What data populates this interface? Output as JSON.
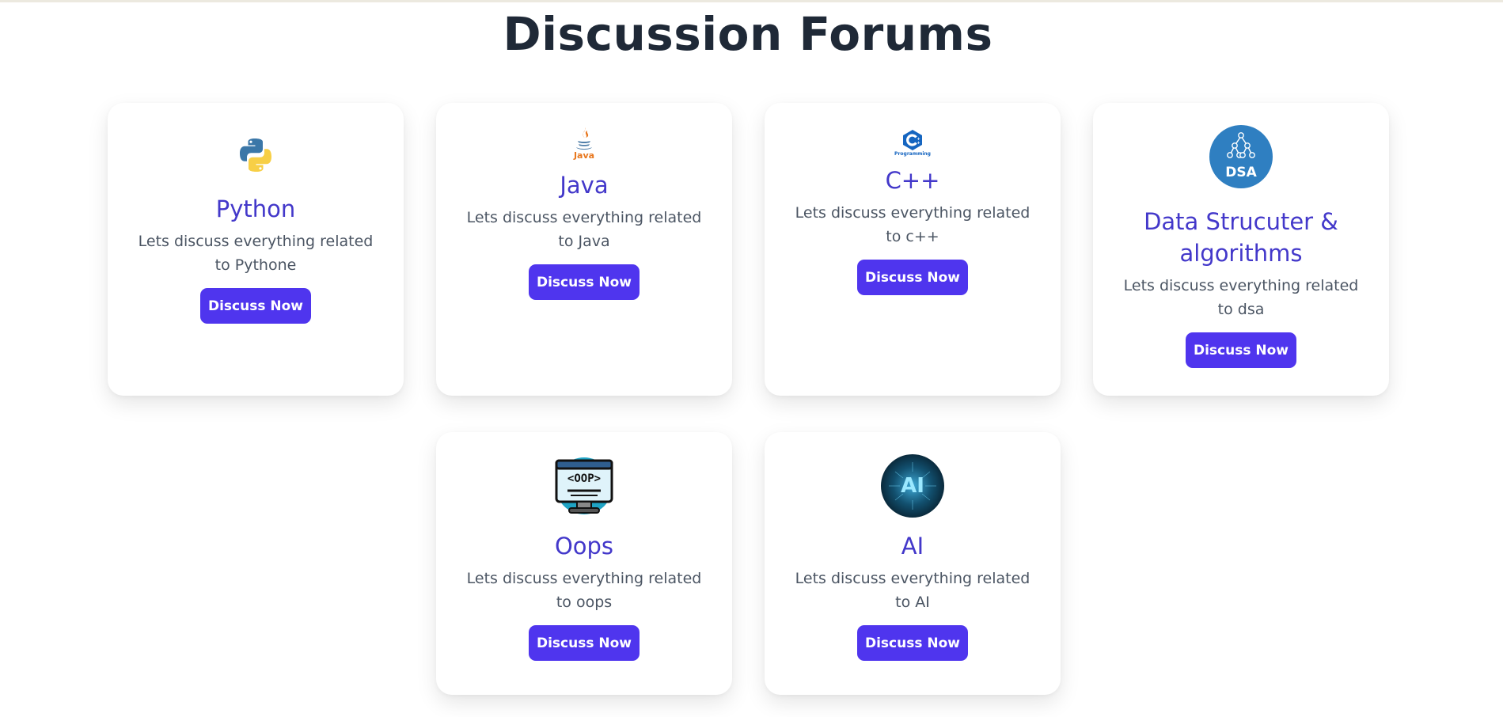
{
  "page": {
    "title": "Discussion Forums"
  },
  "cards": [
    {
      "logo": "python-logo",
      "title": "Python",
      "desc": "Lets discuss everything related to Pythone",
      "button": "Discuss Now"
    },
    {
      "logo": "java-logo",
      "logo_text": "Java",
      "title": "Java",
      "desc": "Lets discuss everything related to Java",
      "button": "Discuss Now"
    },
    {
      "logo": "cpp-logo",
      "logo_text": "Programming",
      "title": "C++",
      "desc": "Lets discuss everything related to c++",
      "button": "Discuss Now"
    },
    {
      "logo": "dsa-logo",
      "logo_text": "DSA",
      "title": "Data Strucuter & algorithms",
      "desc": "Lets discuss everything related to dsa",
      "button": "Discuss Now"
    },
    {
      "logo": "oop-logo",
      "logo_text": "<OOP>",
      "title": "Oops",
      "desc": "Lets discuss everything related to oops",
      "button": "Discuss Now"
    },
    {
      "logo": "ai-logo",
      "logo_text": "AI",
      "title": "AI",
      "desc": "Lets discuss everything related to AI",
      "button": "Discuss Now"
    }
  ],
  "colors": {
    "title": "#1f2937",
    "card_title": "#4338ca",
    "button_bg": "#4f35ee",
    "button_text": "#ffffff",
    "desc": "#4b5563"
  }
}
